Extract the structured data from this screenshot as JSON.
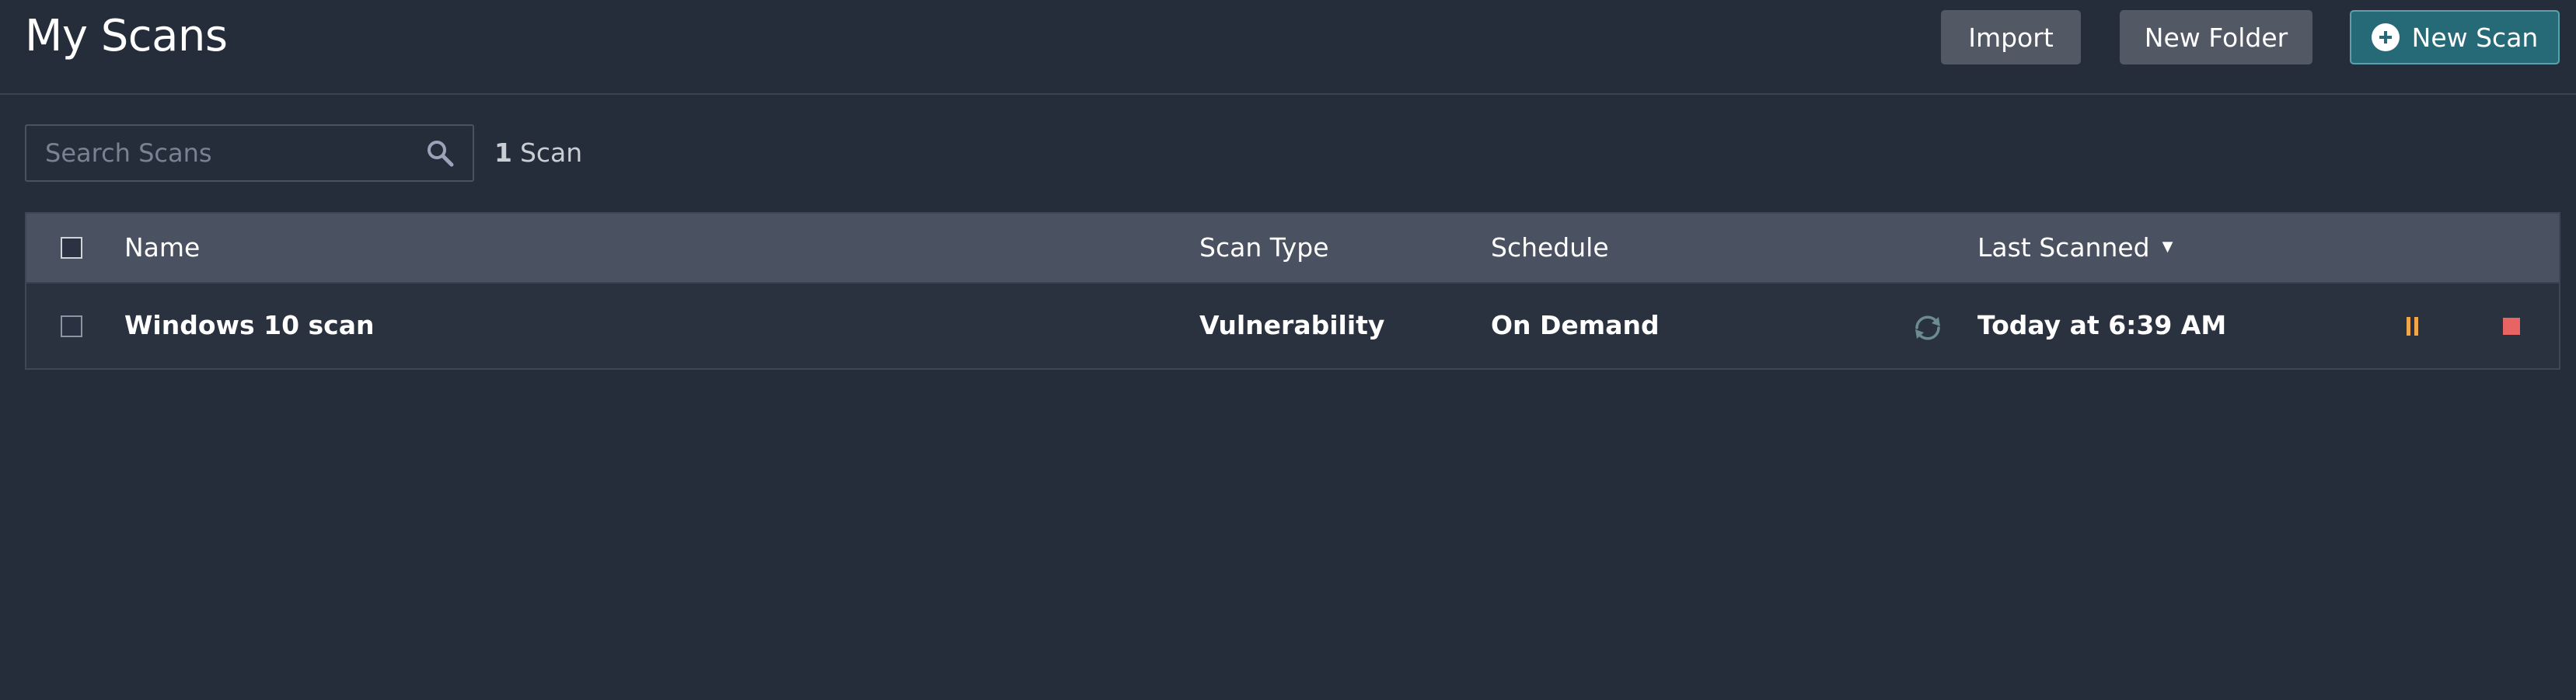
{
  "header": {
    "title": "My Scans",
    "import_label": "Import",
    "new_folder_label": "New Folder",
    "new_scan_label": "New Scan"
  },
  "search": {
    "placeholder": "Search Scans",
    "value": ""
  },
  "summary": {
    "count": "1",
    "unit": "Scan"
  },
  "table": {
    "columns": {
      "name": "Name",
      "scan_type": "Scan Type",
      "schedule": "Schedule",
      "last_scanned": "Last Scanned"
    },
    "sort_indicator": "▼",
    "rows": [
      {
        "name": "Windows 10 scan",
        "scan_type": "Vulnerability",
        "schedule": "On Demand",
        "last_scanned": "Today at 6:39 AM",
        "status_icon": "refresh-icon",
        "actions": [
          "pause-icon",
          "stop-icon"
        ]
      }
    ]
  },
  "colors": {
    "background": "#252c3a",
    "header_row": "#4a5261",
    "accent": "#266a78",
    "pause": "#f0a64b",
    "stop": "#e86464",
    "refresh": "#6b8c92"
  }
}
